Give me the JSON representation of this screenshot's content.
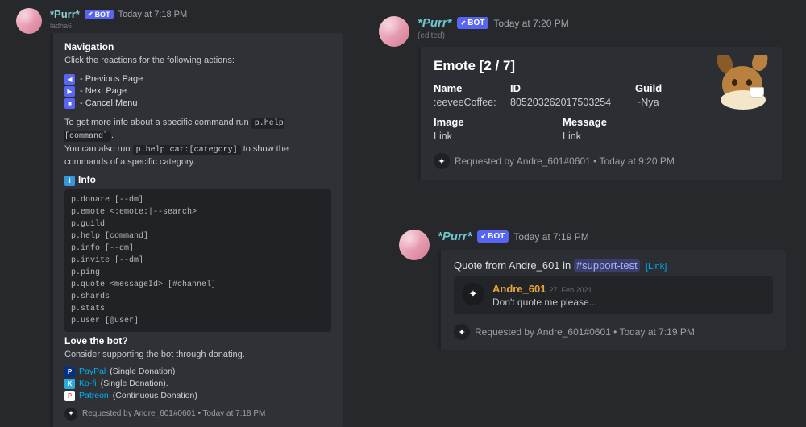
{
  "bot": {
    "name": "*Purr*",
    "tag": "BOT"
  },
  "m1": {
    "timestamp": "Today at 7:18 PM",
    "subline": "ladha6",
    "nav_title": "Navigation",
    "nav_desc": "Click the reactions for the following actions:",
    "r_prev": "- Previous Page",
    "r_next": "- Next Page",
    "r_cancel": "- Cancel Menu",
    "more_p1": "To get more info about a specific command run ",
    "more_code1": "p.help [command]",
    "more_p2": ".",
    "more_p3": "You can also run ",
    "more_code2": "p.help cat:[category]",
    "more_p4": " to show the commands of a specific category.",
    "info_label": "Info",
    "code": "p.donate [--dm]\np.emote <:emote:|--search>\np.guild\np.help [command]\np.info [--dm]\np.invite [--dm]\np.ping\np.quote <messageId> [#channel]\np.shards\np.stats\np.user [@user]",
    "love_title": "Love the bot?",
    "love_desc": "Consider supporting the bot through donating.",
    "d1_name": "PayPal",
    "d1_note": "(Single Donation)",
    "d2_name": "Ko-fi",
    "d2_note": "(Single Donation).",
    "d3_name": "Patreon",
    "d3_note": "(Continuous Donation)",
    "footer": "Requested by Andre_601#0601 • Today at 7:18 PM"
  },
  "m2": {
    "timestamp": "Today at 7:20 PM",
    "edited": "(edited)",
    "title": "Emote [2 / 7]",
    "f_name_l": "Name",
    "f_name_v": ":eeveeCoffee:",
    "f_id_l": "ID",
    "f_id_v": "805203262017503254",
    "f_guild_l": "Guild",
    "f_guild_v": "~Nya",
    "f_image_l": "Image",
    "f_image_v": "Link",
    "f_msg_l": "Message",
    "f_msg_v": "Link",
    "footer": "Requested by Andre_601#0601 • Today at 9:20 PM"
  },
  "m3": {
    "timestamp": "Today at 7:19 PM",
    "quote_prefix": "Quote from Andre_601 in ",
    "channel": "#support-test",
    "link_label": "[Link]",
    "q_user": "Andre_601",
    "q_date": "27. Feb 2021",
    "q_text": "Don't quote me please...",
    "footer": "Requested by Andre_601#0601 • Today at 7:19 PM"
  }
}
